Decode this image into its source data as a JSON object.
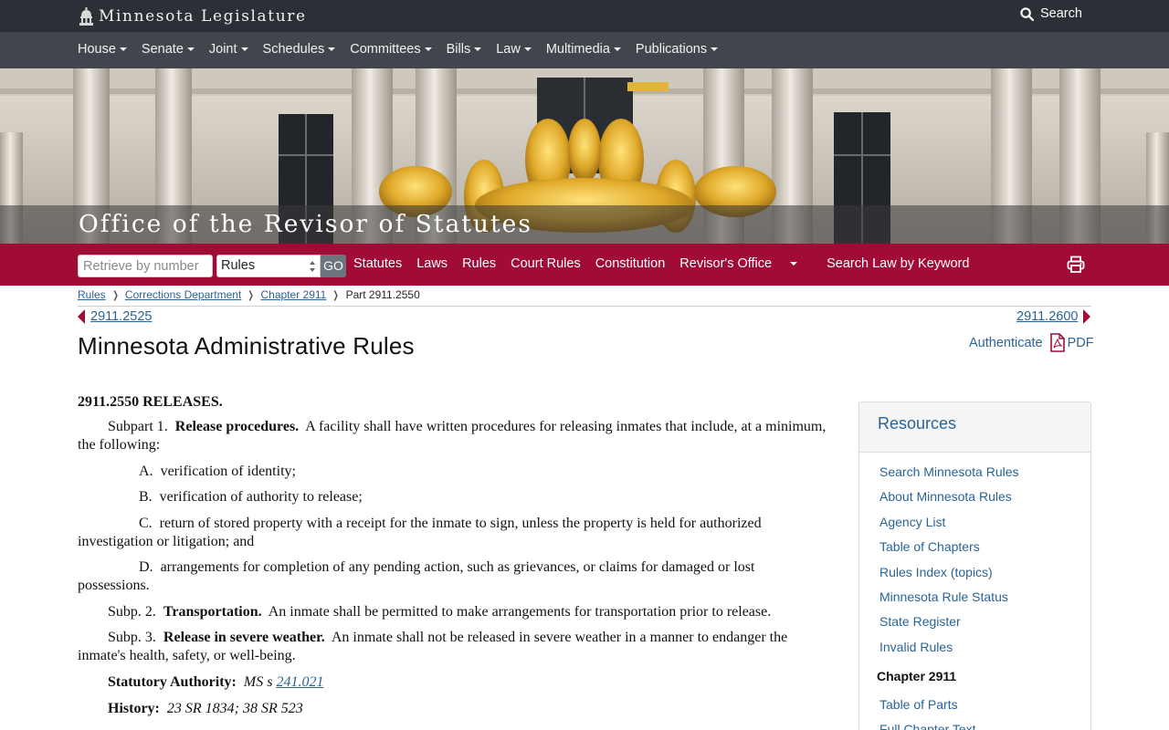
{
  "colors": {
    "topbar": "#2c3036",
    "nav": "#41464d",
    "accent": "#a00c36",
    "link": "#2a6496"
  },
  "topbar": {
    "brand_text": "Minnesota Legislature",
    "brand_icon": "capitol-dome-icon",
    "search_label": "Search"
  },
  "nav": {
    "items": [
      {
        "label": "House"
      },
      {
        "label": "Senate"
      },
      {
        "label": "Joint"
      },
      {
        "label": "Schedules"
      },
      {
        "label": "Committees"
      },
      {
        "label": "Bills"
      },
      {
        "label": "Law"
      },
      {
        "label": "Multimedia"
      },
      {
        "label": "Publications"
      }
    ]
  },
  "hero": {
    "title": "Office of the Revisor of Statutes"
  },
  "toolbar": {
    "retrieve_placeholder": "Retrieve by number",
    "select_value": "Rules",
    "go_label": "GO",
    "links": [
      {
        "label": "Statutes"
      },
      {
        "label": "Laws"
      },
      {
        "label": "Rules"
      },
      {
        "label": "Court Rules"
      },
      {
        "label": "Constitution"
      },
      {
        "label": "Revisor's Office"
      },
      {
        "label": "Search Law by Keyword"
      }
    ],
    "print_icon": "printer-icon"
  },
  "breadcrumb": {
    "items": [
      "Rules",
      "Corrections Department",
      "Chapter 2911"
    ],
    "current": "Part 2911.2550"
  },
  "pager": {
    "prev": "2911.2525",
    "next": "2911.2600"
  },
  "page": {
    "title": "Minnesota Administrative Rules",
    "authenticate": "Authenticate",
    "pdf": "PDF"
  },
  "rule": {
    "heading": "2911.2550 RELEASES.",
    "subpart1": {
      "prefix": "Subpart 1.",
      "title": "Release procedures.",
      "text": "A facility shall have written procedures for releasing inmates that include, at a minimum, the following:"
    },
    "items": [
      {
        "label": "A.",
        "text": "verification of identity;"
      },
      {
        "label": "B.",
        "text": "verification of authority to release;"
      },
      {
        "label": "C.",
        "text": "return of stored property with a receipt for the inmate to sign, unless the property is held for authorized investigation or litigation; and"
      },
      {
        "label": "D.",
        "text": "arrangements for completion of any pending action, such as grievances, or claims for damaged or lost possessions."
      }
    ],
    "subpart2": {
      "prefix": "Subp. 2.",
      "title": "Transportation.",
      "text": "An inmate shall be permitted to make arrangements for transportation prior to release."
    },
    "subpart3": {
      "prefix": "Subp. 3.",
      "title": "Release in severe weather.",
      "text": "An inmate shall not be released in severe weather in a manner to endanger the inmate's health, safety, or well-being."
    },
    "authority_label": "Statutory Authority:",
    "authority_prefix": "MS s",
    "authority_link": "241.021",
    "history_label": "History:",
    "history_text": "23 SR 1834; 38 SR 523"
  },
  "resources": {
    "title": "Resources",
    "links": [
      "Search Minnesota Rules",
      "About Minnesota Rules",
      "Agency List",
      "Table of Chapters",
      "Rules Index (topics)",
      "Minnesota Rule Status",
      "State Register",
      "Invalid Rules"
    ],
    "chapter_heading": "Chapter 2911",
    "chapter_links": [
      "Table of Parts",
      "Full Chapter Text"
    ]
  }
}
